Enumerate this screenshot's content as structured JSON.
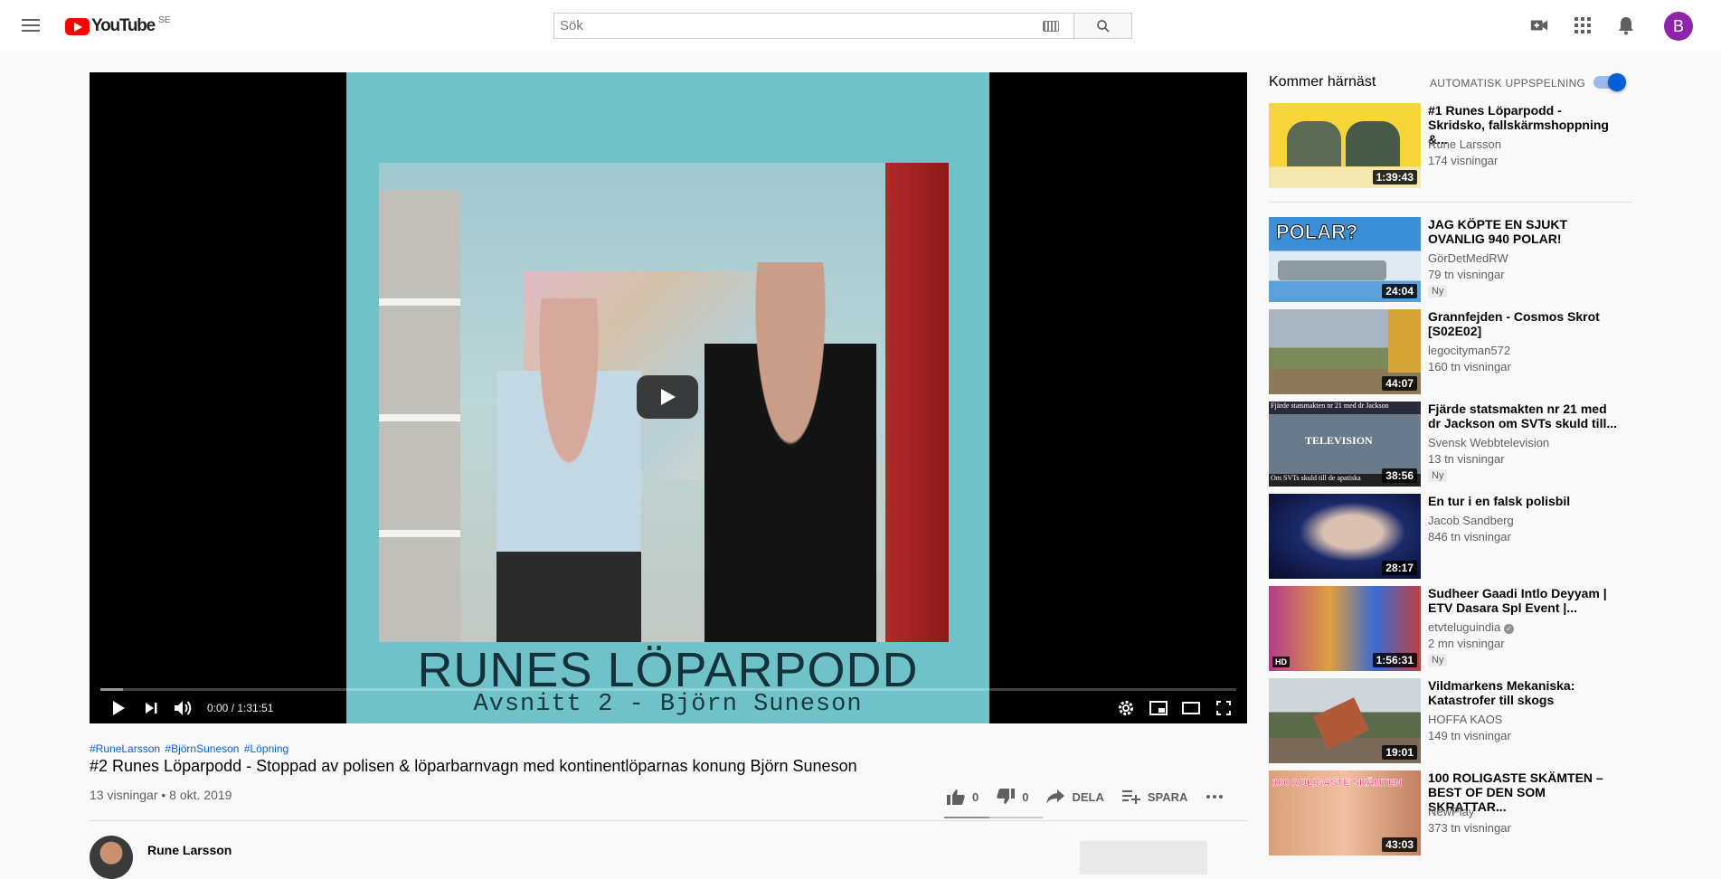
{
  "header": {
    "logo_text": "YouTube",
    "logo_country": "SE",
    "search_placeholder": "Sök",
    "avatar_letter": "B"
  },
  "player": {
    "overlay_title": "RUNES LÖPARPODD",
    "overlay_subtitle": "Avsnitt 2 - Björn Suneson",
    "time": "0:00 / 1:31:51",
    "progress_loaded": 0.02
  },
  "video": {
    "hashtags": [
      "#RuneLarsson",
      "#BjörnSuneson",
      "#Löpning"
    ],
    "title": "#2 Runes Löparpodd - Stoppad av polisen & löparbarnvagn med kontinentlöparnas konung Björn Suneson",
    "meta": "13 visningar • 8 okt. 2019",
    "likes": "0",
    "dislikes": "0",
    "share_label": "DELA",
    "save_label": "SPARA",
    "channel": "Rune Larsson"
  },
  "sidebar": {
    "up_next_label": "Kommer härnäst",
    "autoplay_label": "AUTOMATISK UPPSPELNING",
    "autoplay_on": true,
    "videos": [
      {
        "title": "#1 Runes Löparpodd - Skridsko, fallskärmshoppning &...",
        "channel": "Rune Larsson",
        "views": "174 visningar",
        "duration": "1:39:43",
        "badge": "",
        "hd": ""
      },
      {
        "title": "JAG KÖPTE EN SJUKT OVANLIG 940 POLAR!",
        "channel": "GörDetMedRW",
        "views": "79 tn visningar",
        "duration": "24:04",
        "badge": "Ny",
        "hd": ""
      },
      {
        "title": "Grannfejden - Cosmos Skrot [S02E02]",
        "channel": "legocityman572",
        "views": "160 tn visningar",
        "duration": "44:07",
        "badge": "",
        "hd": ""
      },
      {
        "title": "Fjärde statsmakten nr 21 med dr Jackson om SVTs skuld till...",
        "channel": "Svensk Webbtelevision",
        "views": "13 tn visningar",
        "duration": "38:56",
        "badge": "Ny",
        "hd": ""
      },
      {
        "title": "En tur i en falsk polisbil",
        "channel": "Jacob Sandberg",
        "views": "846 tn visningar",
        "duration": "28:17",
        "badge": "",
        "hd": ""
      },
      {
        "title": "Sudheer Gaadi Intlo Deyyam | ETV Dasara Spl Event |...",
        "channel": "etvteluguindia",
        "views": "2 mn visningar",
        "duration": "1:56:31",
        "badge": "Ny",
        "hd": "HD"
      },
      {
        "title": "Vildmarkens Mekaniska: Katastrofer till skogs",
        "channel": "HOFFA KAOS",
        "views": "149 tn visningar",
        "duration": "19:01",
        "badge": "",
        "hd": ""
      },
      {
        "title": "100 ROLIGASTE SKÄMTEN – BEST OF DEN SOM SKRATTAR...",
        "channel": "NewPlay",
        "views": "373 tn visningar",
        "duration": "43:03",
        "badge": "",
        "hd": ""
      }
    ],
    "thumb_text": {
      "polar": "POLAR?",
      "fjarde_top": "Fjärde statsmakten nr 21 med dr Jackson",
      "fjarde_mid": "TELEVISION",
      "fjarde_bottom": "Om SVTs skuld till de apatiska",
      "roligaste": "100 ROLIGASTE SKÄMTEN"
    }
  },
  "colors": {
    "brand_red": "#ff0000",
    "link_blue": "#065fd4",
    "avatar_purple": "#8e24aa"
  }
}
